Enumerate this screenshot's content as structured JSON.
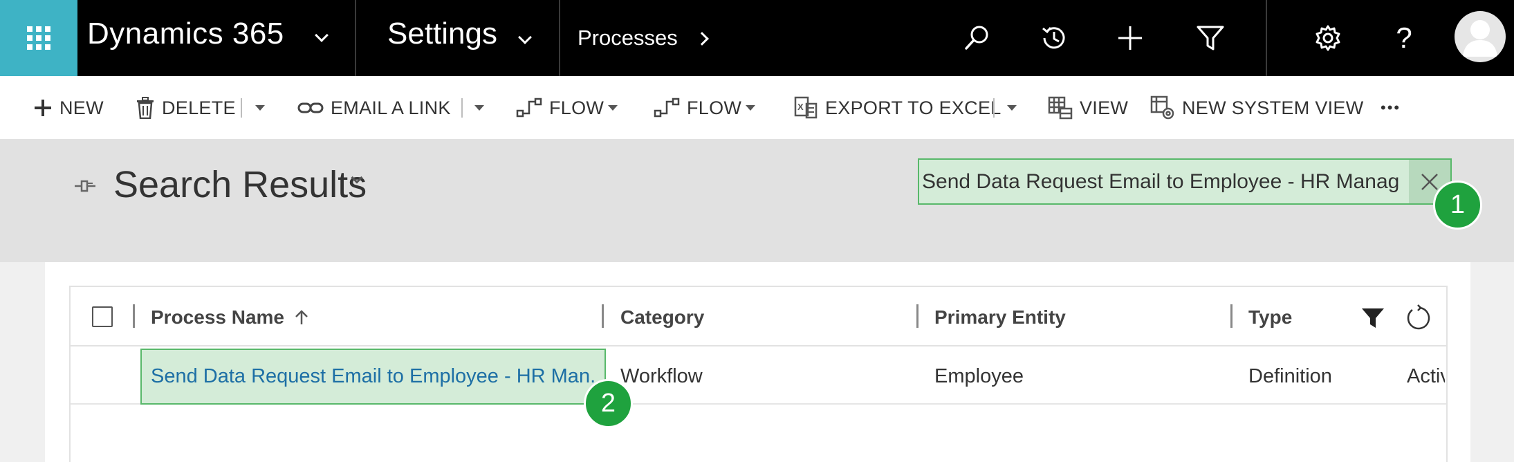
{
  "topnav": {
    "brand": "Dynamics 365",
    "area": "Settings",
    "breadcrumb": "Processes"
  },
  "toolbar": {
    "new": "NEW",
    "delete": "DELETE",
    "email_link": "EMAIL A LINK",
    "flow1": "FLOW",
    "flow2": "FLOW",
    "export": "EXPORT TO EXCEL",
    "view": "VIEW",
    "new_system_view": "NEW SYSTEM VIEW",
    "more": "•••"
  },
  "header": {
    "title": "Search Results",
    "search_value": "Send Data Request Email to Employee - HR Manag"
  },
  "grid": {
    "columns": {
      "name": "Process Name",
      "category": "Category",
      "entity": "Primary Entity",
      "type": "Type"
    },
    "rows": [
      {
        "name": "Send Data Request Email to Employee - HR Man...",
        "category": "Workflow",
        "entity": "Employee",
        "type": "Definition",
        "status": "Activ"
      }
    ]
  },
  "callouts": [
    "1",
    "2"
  ],
  "colors": {
    "nav_bg": "#000000",
    "waffle": "#3eb3c5",
    "highlight_fill": "#d4ecd8",
    "highlight_border": "#58b86a",
    "callout": "#1fa23e",
    "link": "#1d6fa5"
  }
}
